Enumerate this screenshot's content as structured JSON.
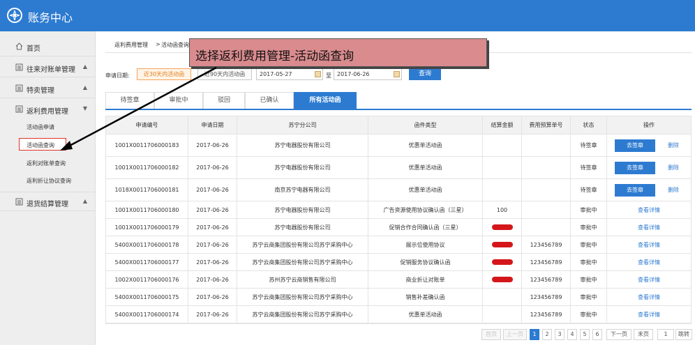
{
  "app": {
    "title": "账务中心",
    "accent_color": "#2d7bd1",
    "icon": "compass-icon"
  },
  "sidebar": {
    "items": [
      {
        "label": "首页",
        "icon": "home-icon"
      },
      {
        "label": "往来对账单管理",
        "icon": "doc-icon",
        "chevron": "▲"
      },
      {
        "label": "特卖管理",
        "icon": "doc-icon",
        "chevron": "▲"
      },
      {
        "label": "返利费用管理",
        "icon": "doc-icon",
        "chevron": "▼"
      },
      {
        "label": "退货结算管理",
        "icon": "doc-icon",
        "chevron": "▲"
      }
    ],
    "subitems": [
      "活动函申请",
      "活动函查询",
      "返利对账单查询",
      "返利折让协议查询"
    ]
  },
  "breadcrumb": {
    "part1": "返利费用管理",
    "separator": ">",
    "part2": "活动函查询"
  },
  "callout": {
    "text": "选择返利费用管理-活动函查询"
  },
  "filter": {
    "label": "申请日期:",
    "quick_30": "近30天内活动函",
    "quick_90": "近90天内活动函",
    "start_date": "2017-05-27",
    "to_label": "至",
    "end_date": "2017-06-26",
    "search_label": "查询"
  },
  "tabs": [
    "待签章",
    "审批中",
    "驳回",
    "已确认",
    "所有活动函"
  ],
  "table": {
    "headers": [
      "申请编号",
      "申请日期",
      "苏宁分公司",
      "函件类型",
      "结算金额",
      "费用预算单号",
      "状态",
      "操作"
    ],
    "rows": [
      {
        "id": "1001X0011706000183",
        "date": "2017-06-26",
        "company": "苏宁电器股份有限公司",
        "type": "优惠单活动函",
        "amount": "",
        "budget": "",
        "status": "待签章",
        "op": "去签章",
        "op2": "删除"
      },
      {
        "id": "1001X0011706000182",
        "date": "2017-06-26",
        "company": "苏宁电器股份有限公司",
        "type": "优惠单活动函",
        "amount": "",
        "budget": "",
        "status": "待签章",
        "op": "去签章",
        "op2": "删除"
      },
      {
        "id": "1018X0011706000181",
        "date": "2017-06-26",
        "company": "南京苏宁电器有限公司",
        "type": "优惠单活动函",
        "amount": "",
        "budget": "",
        "status": "待签章",
        "op": "去签章",
        "op2": "删除"
      },
      {
        "id": "1001X0011706000180",
        "date": "2017-06-26",
        "company": "苏宁电器股份有限公司",
        "type": "广告资源使用协议确认函（三星）",
        "amount": "100",
        "budget": "",
        "status": "审批中",
        "op": "查看详情",
        "op2": ""
      },
      {
        "id": "1001X0011706000179",
        "date": "2017-06-26",
        "company": "苏宁电器股份有限公司",
        "type": "促销合作合同确认函（三星）",
        "amount": "",
        "redacted": true,
        "budget": "",
        "status": "审批中",
        "op": "查看详情",
        "op2": ""
      },
      {
        "id": "5400X0011706000178",
        "date": "2017-06-26",
        "company": "苏宁云商集团股份有限公司苏宁采购中心",
        "type": "展示位使用协议",
        "amount": "",
        "redacted": true,
        "budget": "123456789",
        "status": "审批中",
        "op": "查看详情",
        "op2": ""
      },
      {
        "id": "5400X0011706000177",
        "date": "2017-06-26",
        "company": "苏宁云商集团股份有限公司苏宁采购中心",
        "type": "促销服务协议确认函",
        "amount": "",
        "redacted": true,
        "budget": "123456789",
        "status": "审批中",
        "op": "查看详情",
        "op2": ""
      },
      {
        "id": "1002X0011706000176",
        "date": "2017-06-26",
        "company": "苏州苏宁云商销售有限公司",
        "type": "商业折让对账单",
        "amount": "",
        "redacted": true,
        "budget": "123456789",
        "status": "审批中",
        "op": "查看详情",
        "op2": ""
      },
      {
        "id": "5400X0011706000175",
        "date": "2017-06-26",
        "company": "苏宁云商集团股份有限公司苏宁采购中心",
        "type": "销售补差确认函",
        "amount": "",
        "budget": "123456789",
        "status": "审批中",
        "op": "查看详情",
        "op2": ""
      },
      {
        "id": "5400X0011706000174",
        "date": "2017-06-26",
        "company": "苏宁云商集团股份有限公司苏宁采购中心",
        "type": "优惠单活动函",
        "amount": "",
        "budget": "123456789",
        "status": "审批中",
        "op": "查看详情",
        "op2": ""
      }
    ]
  },
  "pagination": {
    "first": "首页",
    "prev": "上一页",
    "pages": [
      "1",
      "2",
      "3",
      "4",
      "5",
      "6"
    ],
    "current": "1",
    "next": "下一页",
    "last": "末页",
    "jump_value": "1",
    "jump": "跳转"
  }
}
